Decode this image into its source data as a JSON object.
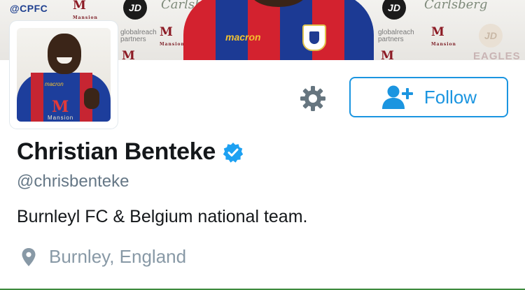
{
  "banner": {
    "sponsors": {
      "club_tag": "@CPFC",
      "mansion": "Mansion",
      "jd": "JD",
      "carlsberg": "Carlsberg",
      "globalreach": "globalreach",
      "globalreach_sub": "partners",
      "eagles": "EAGLES",
      "macron": "macron"
    }
  },
  "profile": {
    "display_name": "Christian Benteke",
    "verified": true,
    "handle": "@chrisbenteke",
    "bio": "Burnleyl FC & Belgium national team.",
    "location": "Burnley, England"
  },
  "actions": {
    "follow_label": "Follow"
  },
  "icons": {
    "settings": "gear-icon",
    "follow": "add-user-icon",
    "verified": "verified-badge-icon",
    "location": "map-pin-icon"
  },
  "colors": {
    "accent": "#1b95e0",
    "verified": "#1da1f2",
    "muted": "#657786",
    "icon_gray": "#66757f"
  }
}
